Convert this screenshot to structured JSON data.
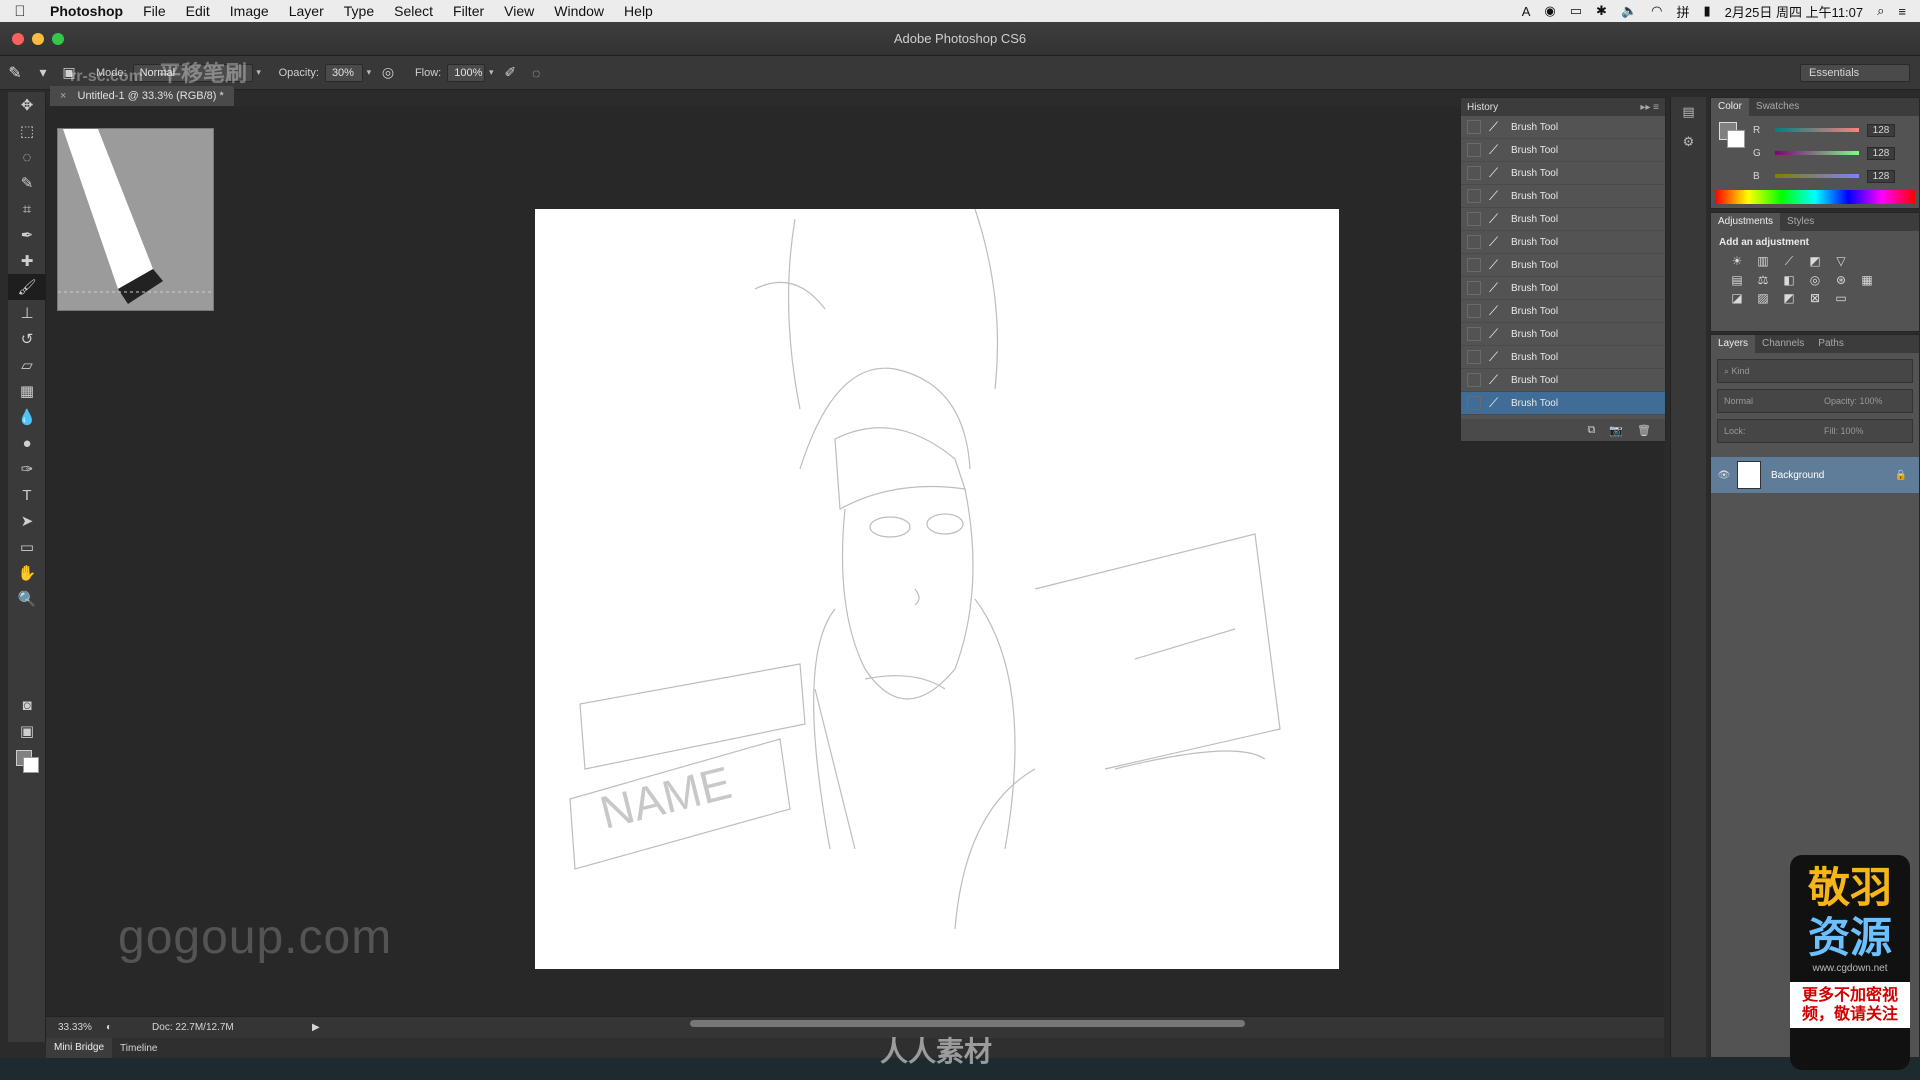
{
  "menubar": {
    "items": [
      "Photoshop",
      "File",
      "Edit",
      "Image",
      "Layer",
      "Type",
      "Select",
      "Filter",
      "View",
      "Window",
      "Help"
    ],
    "datetime": "2月25日 周四 上午11:07"
  },
  "window": {
    "title": "Adobe Photoshop CS6"
  },
  "options": {
    "mode_label": "Mode:",
    "mode_value": "Normal",
    "opacity_label": "Opacity:",
    "opacity_value": "30%",
    "flow_label": "Flow:",
    "flow_value": "100%",
    "workspace": "Essentials"
  },
  "document": {
    "tab_title": "Untitled-1 @ 33.3% (RGB/8) *",
    "zoom": "33.33%",
    "doc_size": "Doc: 22.7M/12.7M",
    "canvas_text": "NAME"
  },
  "bottom_tabs": [
    "Mini Bridge",
    "Timeline"
  ],
  "history": {
    "title": "History",
    "items": [
      "Brush Tool",
      "Brush Tool",
      "Brush Tool",
      "Brush Tool",
      "Brush Tool",
      "Brush Tool",
      "Brush Tool",
      "Brush Tool",
      "Brush Tool",
      "Brush Tool",
      "Brush Tool",
      "Brush Tool",
      "Brush Tool"
    ]
  },
  "color_panel": {
    "tabs": [
      "Color",
      "Swatches"
    ],
    "channels": [
      {
        "name": "R",
        "value": "128"
      },
      {
        "name": "G",
        "value": "128"
      },
      {
        "name": "B",
        "value": "128"
      }
    ],
    "foreground": "#808080",
    "background": "#ffffff"
  },
  "adjustments": {
    "tabs": [
      "Adjustments",
      "Styles"
    ],
    "heading": "Add an adjustment"
  },
  "layers": {
    "tabs": [
      "Layers",
      "Channels",
      "Paths"
    ],
    "kind_label": "Kind",
    "blend_mode": "Normal",
    "opacity_label": "Opacity:",
    "opacity_value": "100%",
    "lock_label": "Lock:",
    "fill_label": "Fill:",
    "fill_value": "100%",
    "layer_name": "Background"
  },
  "watermarks": {
    "tool_name": "平移笔刷",
    "site_top": "rr-sc.com",
    "gogoup": "gogoup.com",
    "bottom_brand": "人人素材",
    "promo_line1": "敬羽",
    "promo_line2": "资源",
    "promo_site": "www.cgdown.net",
    "promo_note": "更多不加密视频，敬请关注"
  }
}
